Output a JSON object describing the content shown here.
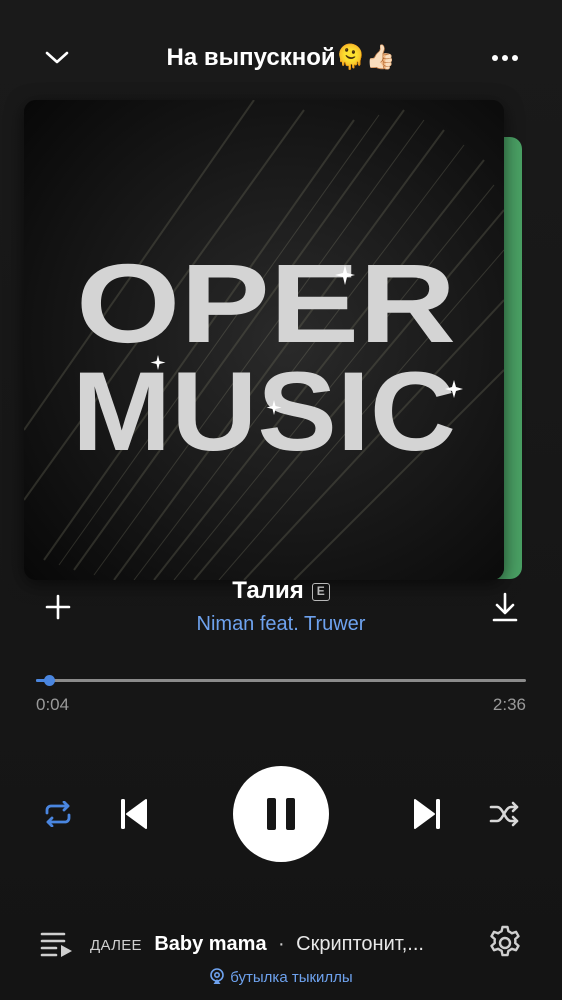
{
  "header": {
    "playlist_title": "На выпускной",
    "title_emoji": "🫠👍🏻",
    "collapse_icon": "chevron-down-icon",
    "more_icon": "more-horizontal-icon"
  },
  "artwork": {
    "line1": "OPER",
    "line2": "MUSIC",
    "next_card_color": "#4aa064"
  },
  "track": {
    "title": "Талия",
    "explicit_badge": "E",
    "artist": "Niman feat. Truwer",
    "add_icon": "plus-icon",
    "download_icon": "download-icon"
  },
  "playback": {
    "current_time": "0:04",
    "total_time": "2:36",
    "progress_fraction": 0.026,
    "accent_color": "#4a86e0"
  },
  "controls": {
    "repeat_icon": "repeat-icon",
    "previous_icon": "skip-previous-icon",
    "pause_icon": "pause-icon",
    "next_icon": "skip-next-icon",
    "shuffle_icon": "shuffle-icon"
  },
  "queue": {
    "next_label": "ДАЛЕЕ",
    "next_song": "Baby mama",
    "separator": "·",
    "next_artist": "Скриптонит,...",
    "queue_icon": "queue-icon",
    "settings_icon": "gear-icon"
  },
  "device": {
    "name": "бутылка тыкиллы",
    "icon": "airplay-icon"
  }
}
